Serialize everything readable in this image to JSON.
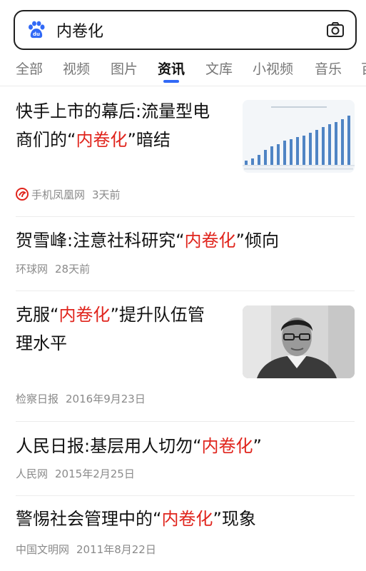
{
  "search": {
    "query": "内卷化",
    "logo_icon": "baidu-paw-logo",
    "camera_icon": "camera-icon"
  },
  "tabs": [
    {
      "label": "全部"
    },
    {
      "label": "视频"
    },
    {
      "label": "图片"
    },
    {
      "label": "资讯",
      "active": true
    },
    {
      "label": "文库"
    },
    {
      "label": "小视频"
    },
    {
      "label": "音乐"
    },
    {
      "label": "百"
    }
  ],
  "results": [
    {
      "title_pre": "快手上市的幕后:流量型电",
      "title_line2_pre": "商们的“",
      "title_hl": "内卷化",
      "title_post": "”暗结",
      "source": "手机凤凰网",
      "time": "3天前",
      "source_icon": "ifeng-logo-icon",
      "thumbnail": "bar-chart-thumbnail"
    },
    {
      "title_pre": "贺雪峰:注意社科研究“",
      "title_hl": "内卷化",
      "title_post": "”倾向",
      "source": "环球网",
      "time": "28天前"
    },
    {
      "title_pre": "克服“",
      "title_hl": "内卷化",
      "title_post": "”提升队伍管",
      "title_line2": "理水平",
      "source": "检察日报",
      "time": "2016年9月23日",
      "thumbnail": "portrait-photo-thumbnail"
    },
    {
      "title_pre": "人民日报:基层用人切勿“",
      "title_hl": "内卷化",
      "title_post": "”",
      "source": "人民网",
      "time": "2015年2月25日"
    },
    {
      "title_pre": "警惕社会管理中的“",
      "title_hl": "内卷化",
      "title_post": "”现象",
      "source": "中国文明网",
      "time": "2011年8月22日"
    }
  ],
  "colors": {
    "highlight": "#e0241c",
    "accent": "#3169f6",
    "meta": "#8a8a8a"
  }
}
